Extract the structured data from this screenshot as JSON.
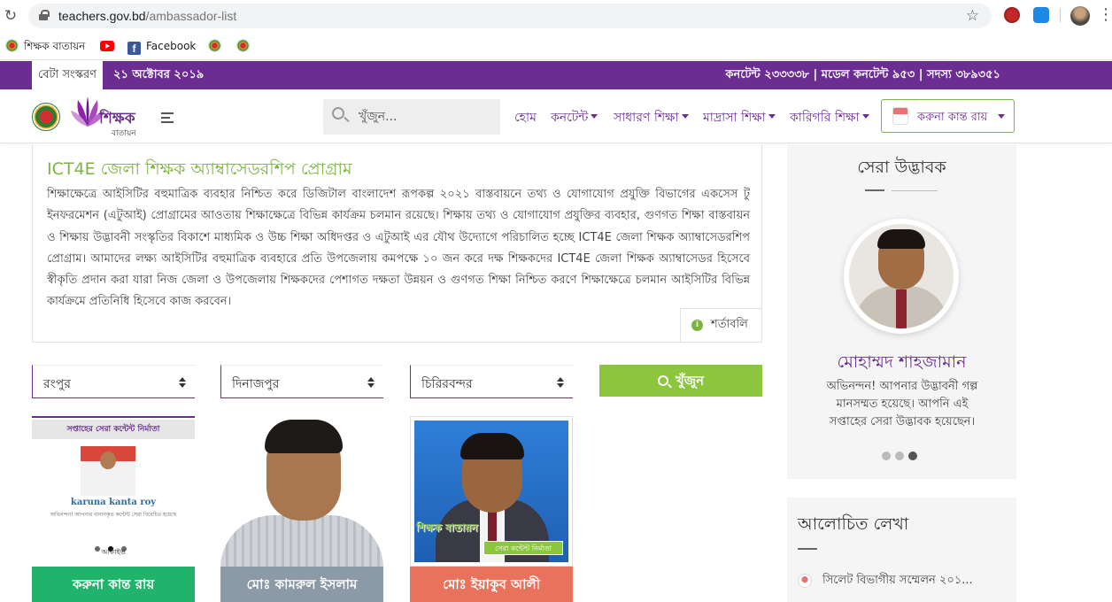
{
  "browser": {
    "url_host": "teachers.gov.bd",
    "url_path": "/ambassador-list",
    "bookmarks": [
      {
        "label": "শিক্ষক বাতায়ন",
        "icon": "gov-seal-icon"
      },
      {
        "label": "",
        "icon": "youtube-icon"
      },
      {
        "label": "Facebook",
        "icon": "facebook-icon"
      },
      {
        "label": "",
        "icon": "gov-seal-icon"
      },
      {
        "label": "",
        "icon": "gov-seal-icon"
      }
    ]
  },
  "topbar": {
    "beta": "বেটা সংস্করণ",
    "date": "২১ অক্টোবর ২০১৯",
    "stats": "কনটেন্ট ২৩৩৩৩৮ | মডেল কনটেন্ট ৯৫৩ | সদস্য ৩৮৯৩৫১"
  },
  "header": {
    "logo_text": "শিক্ষক",
    "logo_sub": "বাতায়ন",
    "search_placeholder": "খুঁজুন...",
    "nav": [
      {
        "label": "হোম",
        "dropdown": false
      },
      {
        "label": "কনটেন্ট",
        "dropdown": true
      },
      {
        "label": "সাধারণ শিক্ষা",
        "dropdown": true
      },
      {
        "label": "মাদ্রাসা শিক্ষা",
        "dropdown": true
      },
      {
        "label": "কারিগরি শিক্ষা",
        "dropdown": true
      }
    ],
    "user_name": "করুনা কান্ত রায়"
  },
  "intro": {
    "title": "ICT4E জেলা শিক্ষক অ্যাম্বাসেডরশিপ প্রোগ্রাম",
    "body": "শিক্ষাক্ষেত্রে আইসিটির বহুমাত্রিক ব্যবহার নিশ্চিত করে ডিজিটাল বাংলাদেশ রূপকল্প ২০২১ বাস্তবায়নে তথ্য ও যোগাযোগ প্রযুক্তি বিভাগের একসেস টু ইনফরমেশন (এটুআই) প্রোগ্রামের আওতায় শিক্ষাক্ষেত্রে বিভিন্ন কার্যক্রম চলমান রয়েছে। শিক্ষায় তথ্য ও যোগাযোগ প্রযুক্তির ব্যবহার, গুণগত শিক্ষা বাস্তবায়ন ও শিক্ষায় উদ্ভাবনী সংস্কৃতির বিকাশে মাধ্যমিক ও উচ্চ শিক্ষা অধিদপ্তর ও এটুআই এর যৌথ উদ্যোগে পরিচালিত হচ্ছে ICT4E জেলা শিক্ষক অ্যাম্বাসেডরশিপ প্রোগ্রাম। আমাদের লক্ষ্য আইসিটির বহুমাত্রিক ব্যবহারে প্রতি উপজেলায় কমপক্ষে ১০ জন করে দক্ষ শিক্ষকদের ICT4E জেলা শিক্ষক অ্যাম্বাসেডর হিসেবে স্বীকৃতি প্রদান করা যারা নিজ জেলা ও উপজেলায় শিক্ষকদের পেশাগত দক্ষতা উন্নয়ন ও গুণগত শিক্ষা নিশ্চিত করণে শিক্ষাক্ষেত্রে চলমান আইসিটির বিভিন্ন কার্যক্রমে প্রতিনিধি হিসেবে কাজ করবেন।",
    "terms": "শর্তাবলি"
  },
  "filters": {
    "division": "রংপুর",
    "district": "দিনাজপুর",
    "upazila": "চিরিরবন্দর",
    "search_label": "খুঁজুন"
  },
  "ambassadors": [
    {
      "name": "করুনা কান্ত রায়",
      "color": "#20b36b",
      "banner_title": "সপ্তাহের সেরা কন্টেন্ট নির্মাতা",
      "banner_name": "karuna kanta roy",
      "banner_text": "অভিনন্দন! আপনার বানানকৃত কন্টেন্ট সেরা বিবেচিত হয়েছে",
      "banner_footer": "আর্কাইভ"
    },
    {
      "name": "মোঃ কামরুল ইসলাম",
      "color": "#8b9aa6"
    },
    {
      "name": "মোঃ ইয়াকুব আলী",
      "color": "#e8725c",
      "logo_text": "শিক্ষক বাতায়ন",
      "ribbon": "সেরা কন্টেন্ট নির্মাতা"
    }
  ],
  "sidebar": {
    "best_innovator": {
      "title": "সেরা উদ্ভাবক",
      "name": "মোহাম্মদ শাহজামান",
      "message": "অভিনন্দন! আপনার উদ্ভাবনী গল্প মানসম্মত হয়েছে। আপনি এই সপ্তাহের সেরা উদ্ভাবক হয়েছেন।",
      "carousel_count": 3,
      "carousel_active": 3
    },
    "discussed": {
      "title": "আলোচিত লেখা",
      "items": [
        "সিলেট বিভাগীয় সম্মেলন ২০১..."
      ]
    }
  }
}
